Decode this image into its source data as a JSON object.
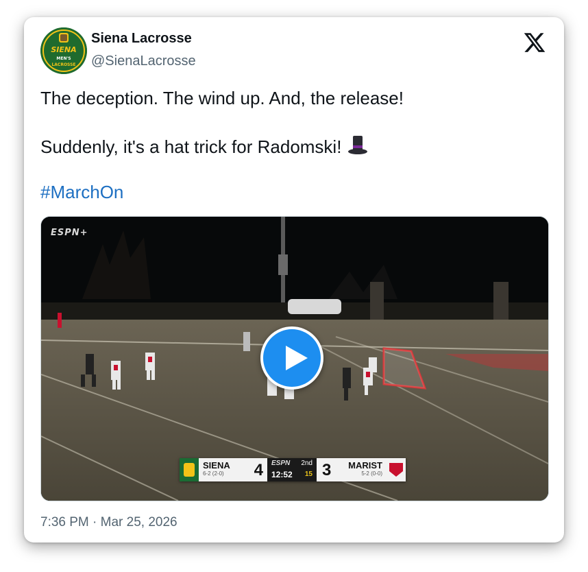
{
  "account": {
    "display_name": "Siena Lacrosse",
    "handle": "@SienaLacrosse",
    "avatar_text_top": "SIENA",
    "avatar_text_mid": "MEN'S",
    "avatar_text_bottom": "LACROSSE"
  },
  "tweet": {
    "line1": "The deception.  The wind up.  And, the release!",
    "line2": "Suddenly, it's a hat trick for Radomski!",
    "hashtag": "#MarchOn",
    "timestamp": "7:36 PM · Mar 25, 2026"
  },
  "video": {
    "network_bug": "ESPN+",
    "scorebug": {
      "home_name": "SIENA",
      "home_record": "6-2 (2-0)",
      "home_score": "4",
      "network": "ESPN",
      "period": "2nd",
      "clock": "12:52",
      "shot_clock": "15",
      "away_score": "3",
      "away_name": "MARIST",
      "away_record": "5-2 (0-0)"
    }
  },
  "icons": {
    "x_logo": "x-logo-icon",
    "play": "play-icon",
    "hat": "top-hat-emoji"
  },
  "colors": {
    "link": "#1d6fc2",
    "name": "#0f1419",
    "secondary": "#536471",
    "play_button": "#1d8ef0"
  }
}
